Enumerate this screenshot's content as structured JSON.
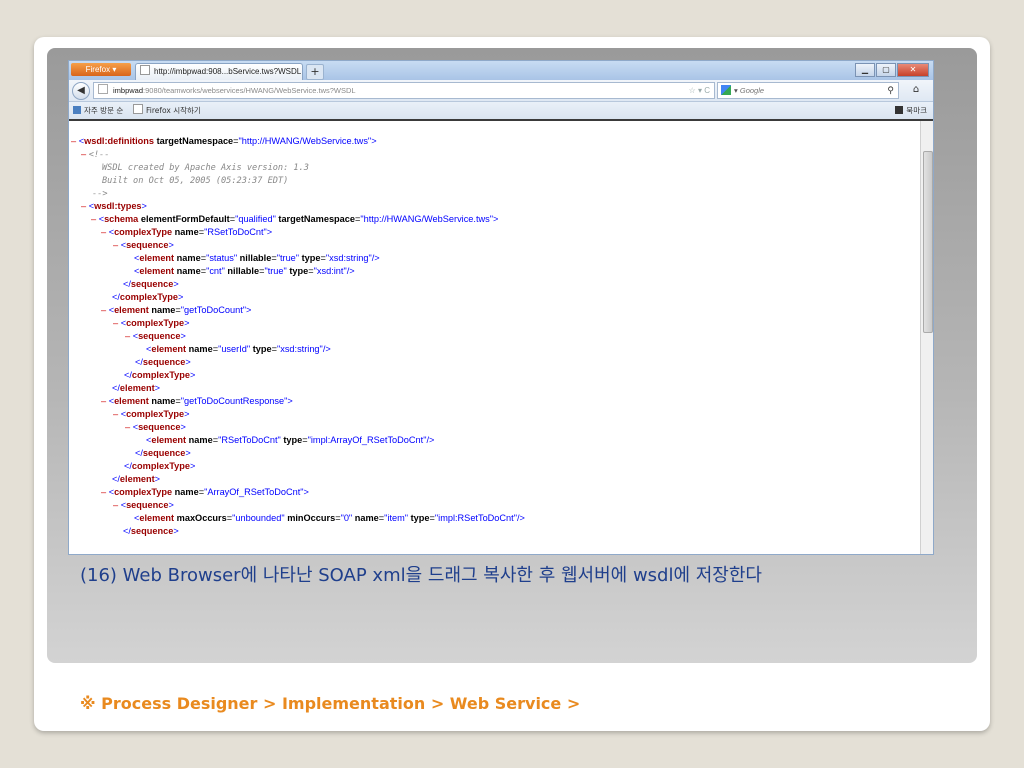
{
  "browser": {
    "app_button": "Firefox",
    "tab_title": "http://imbpwad:908...bService.tws?WSDL",
    "new_tab": "+",
    "url_host": "imbpwad",
    "url_rest": ":9080/teamworks/webservices/HWANG/WebService.tws?WSDL",
    "url_tools": "☆ ▾ C",
    "search_placeholder": "Google",
    "bookmarks": [
      "자주 방문 순",
      "Firefox 시작하기"
    ],
    "bookmarks_menu": "북마크"
  },
  "xml": {
    "definitions_tag": "wsdl:definitions",
    "target_ns_attr": "targetNamespace",
    "target_ns_val": "\"http://HWANG/WebService.tws\"",
    "comment_open": "<!--",
    "comment_line1": "WSDL created by Apache Axis version: 1.3",
    "comment_line2": "Built on Oct 05, 2005 (05:23:37 EDT)",
    "comment_close": "-->",
    "types_tag": "wsdl:types",
    "schema_tag": "schema",
    "efd_attr": "elementFormDefault",
    "efd_val": "\"qualified\"",
    "complexType": "complexType",
    "sequence": "sequence",
    "element": "element",
    "name_attr": "name",
    "nillable_attr": "nillable",
    "type_attr": "type",
    "maxOccurs_attr": "maxOccurs",
    "minOccurs_attr": "minOccurs",
    "v_RSetToDoCnt": "\"RSetToDoCnt\"",
    "v_status": "\"status\"",
    "v_true": "\"true\"",
    "v_string": "\"xsd:string\"",
    "v_cnt": "\"cnt\"",
    "v_int": "\"xsd:int\"",
    "v_getToDoCount": "\"getToDoCount\"",
    "v_userId": "\"userId\"",
    "v_getToDoCountResponse": "\"getToDoCountResponse\"",
    "v_arrayType": "\"impl:ArrayOf_RSetToDoCnt\"",
    "v_ArrayOf": "\"ArrayOf_RSetToDoCnt\"",
    "v_unbounded": "\"unbounded\"",
    "v_zero": "\"0\"",
    "v_item": "\"item\"",
    "v_implR": "\"impl:RSetToDoCnt\""
  },
  "caption": "(16) Web Browser에 나타난 SOAP xml을 드래그 복사한 후 웹서버에 wsdl에 저장한다",
  "footer": "※ Process Designer > Implementation > Web Service >"
}
